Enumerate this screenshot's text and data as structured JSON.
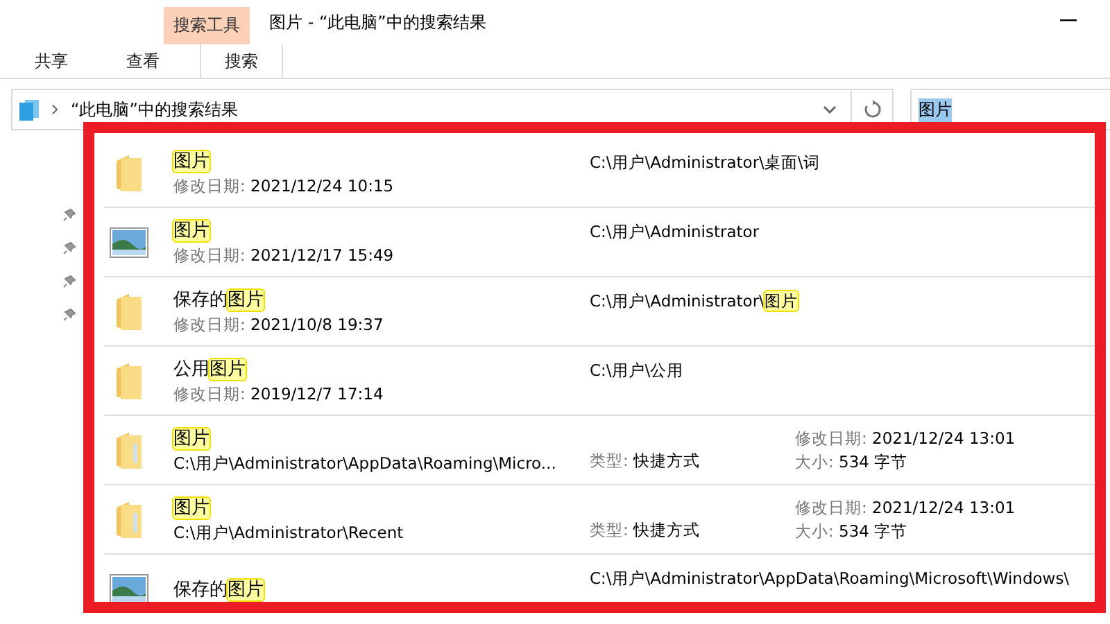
{
  "window": {
    "title": "图片 - “此电脑”中的搜索结果",
    "context_tab": "搜索工具"
  },
  "tabs": [
    {
      "label": "共享",
      "selected": false
    },
    {
      "label": "查看",
      "selected": false
    },
    {
      "label": "搜索",
      "selected": true
    }
  ],
  "address_bar": {
    "path": "“此电脑”中的搜索结果"
  },
  "search": {
    "value": "图片"
  },
  "results": [
    {
      "kind": "folder",
      "name_parts": [
        {
          "text": "图片",
          "highlighted": true
        }
      ],
      "meta_label": "修改日期:",
      "meta_value": "2021/12/24 10:15",
      "path_parts": [
        {
          "text": "C:\\用户\\Administrator\\桌面\\词",
          "highlighted": false
        }
      ]
    },
    {
      "kind": "image",
      "name_parts": [
        {
          "text": "图片",
          "highlighted": true
        }
      ],
      "meta_label": "修改日期:",
      "meta_value": "2021/12/17 15:49",
      "path_parts": [
        {
          "text": "C:\\用户\\Administrator",
          "highlighted": false
        }
      ]
    },
    {
      "kind": "folder",
      "name_parts": [
        {
          "text": "保存的",
          "highlighted": false
        },
        {
          "text": "图片",
          "highlighted": true
        }
      ],
      "meta_label": "修改日期:",
      "meta_value": "2021/10/8 19:37",
      "path_parts": [
        {
          "text": "C:\\用户\\Administrator\\",
          "highlighted": false
        },
        {
          "text": "图片",
          "highlighted": true
        }
      ]
    },
    {
      "kind": "folder",
      "name_parts": [
        {
          "text": "公用",
          "highlighted": false
        },
        {
          "text": "图片",
          "highlighted": true
        }
      ],
      "meta_label": "修改日期:",
      "meta_value": "2019/12/7 17:14",
      "path_parts": [
        {
          "text": "C:\\用户\\公用",
          "highlighted": false
        }
      ]
    },
    {
      "kind": "shortcut",
      "name_parts": [
        {
          "text": "图片",
          "highlighted": true
        }
      ],
      "location": "C:\\用户\\Administrator\\AppData\\Roaming\\Micro...",
      "type_label": "类型:",
      "type_value": "快捷方式",
      "date_label": "修改日期:",
      "date_value": "2021/12/24 13:01",
      "size_label": "大小:",
      "size_value": "534 字节"
    },
    {
      "kind": "shortcut",
      "name_parts": [
        {
          "text": "图片",
          "highlighted": true
        }
      ],
      "location": "C:\\用户\\Administrator\\Recent",
      "type_label": "类型:",
      "type_value": "快捷方式",
      "date_label": "修改日期:",
      "date_value": "2021/12/24 13:01",
      "size_label": "大小:",
      "size_value": "534 字节"
    },
    {
      "kind": "image",
      "name_parts": [
        {
          "text": "保存的",
          "highlighted": false
        },
        {
          "text": "图片",
          "highlighted": true
        }
      ],
      "path_parts": [
        {
          "text": "C:\\用户\\Administrator\\AppData\\Roaming\\Microsoft\\Windows\\",
          "highlighted": false
        }
      ]
    }
  ]
}
